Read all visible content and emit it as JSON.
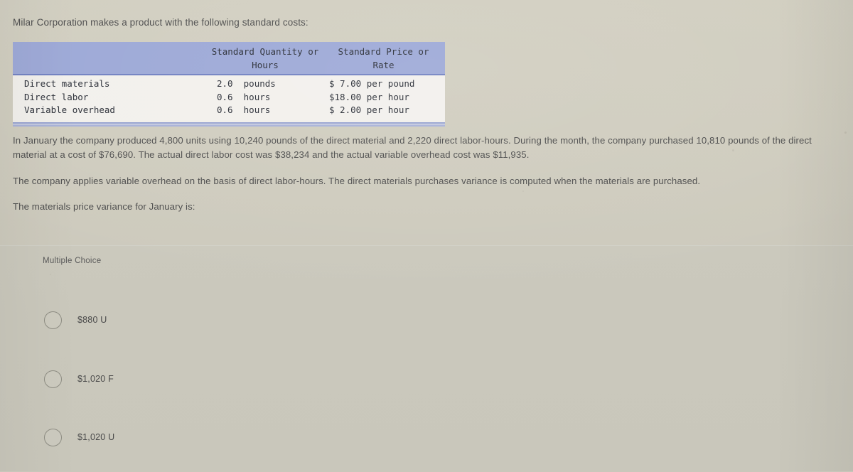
{
  "question": {
    "intro": "Milar Corporation makes a product with the following standard costs:",
    "paragraph_1": "In January the company produced 4,800 units using 10,240 pounds of the direct material and 2,220 direct labor-hours. During the month, the company purchased 10,810 pounds of the direct material at a cost of $76,690. The actual direct labor cost was $38,234 and the actual variable overhead cost was $11,935.",
    "paragraph_2": "The company applies variable overhead on the basis of direct labor-hours. The direct materials purchases variance is computed when the materials are purchased.",
    "paragraph_3": "The materials price variance for January is:"
  },
  "cost_table": {
    "headers": {
      "blank": "",
      "quantity_line1": "Standard Quantity or",
      "quantity_line2": "Hours",
      "rate_line1": "Standard Price or",
      "rate_line2": "Rate"
    },
    "rows": [
      {
        "label": "Direct materials",
        "quantity": "2.0",
        "quantity_unit": "pounds",
        "rate": "$ 7.00",
        "rate_unit": "per pound"
      },
      {
        "label": "Direct labor",
        "quantity": "0.6",
        "quantity_unit": "hours",
        "rate": "$18.00",
        "rate_unit": "per hour"
      },
      {
        "label": "Variable overhead",
        "quantity": "0.6",
        "quantity_unit": "hours",
        "rate": "$ 2.00",
        "rate_unit": "per hour"
      }
    ],
    "header_color": "#9ba7d6",
    "body_color": "#f2f0ec"
  },
  "answer_section": {
    "type_label": "Multiple Choice",
    "options": [
      {
        "id": "option-a",
        "label": "$880 U",
        "selected": false
      },
      {
        "id": "option-b",
        "label": "$1,020 F",
        "selected": false
      },
      {
        "id": "option-c",
        "label": "$1,020 U",
        "selected": false
      }
    ]
  },
  "colors": {
    "page_background": "#cdcabc",
    "answer_panel_background": "#c9c7bb",
    "text": "#4d4d4d",
    "table_header": "#9ba7d6",
    "table_rule": "#8f9ccd"
  }
}
